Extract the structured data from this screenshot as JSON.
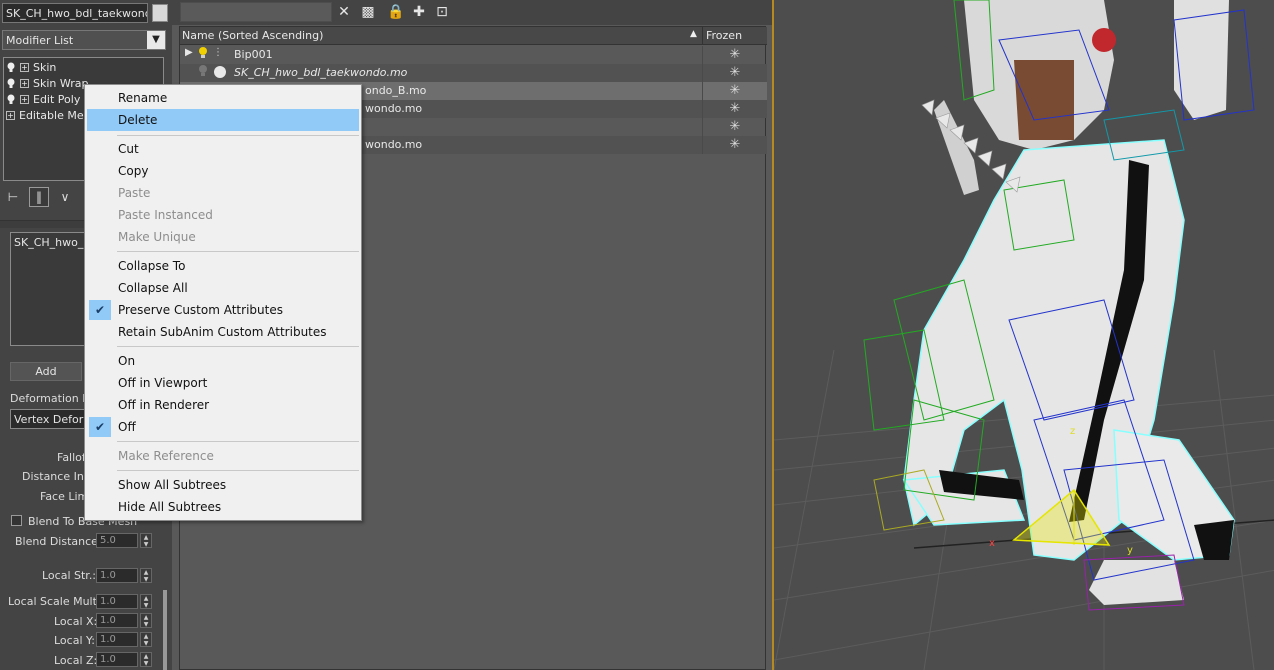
{
  "command_panel": {
    "object_name": "SK_CH_hwo_bdl_taekwondo_",
    "modifier_list_label": "Modifier List",
    "stack": [
      "Skin",
      "Skin Wrap",
      "Edit Poly",
      "Editable Mesh"
    ],
    "list_item": "SK_CH_hwo_b",
    "add_button": "Add",
    "deformation_label": "Deformation En",
    "deformation_value": "Vertex Deform",
    "falloff_label": "Fallof",
    "distance_infl_label": "Distance Infl",
    "face_limit_label": "Face Limi",
    "blend_to_base_label": "Blend To Base Mesh",
    "blend_distance_label": "Blend Distance:",
    "blend_distance_value": "5.0",
    "local_str_label": "Local Str.:",
    "local_str_value": "1.0",
    "local_scale_label": "Local Scale Mult.:",
    "local_scale_value": "1.0",
    "local_x_label": "Local X:",
    "local_x_value": "1.0",
    "local_y_label": "Local Y:",
    "local_y_value": "1.0",
    "local_z_label": "Local Z:",
    "local_z_value": "1.0"
  },
  "scene_explorer": {
    "search_value": "",
    "col_name": "Name (Sorted Ascending)",
    "col_frozen": "Frozen",
    "rows": [
      {
        "name": "Bip001"
      },
      {
        "name": "SK_CH_hwo_bdl_taekwondo.mo"
      },
      {
        "name": "ondo_B.mo"
      },
      {
        "name": "wondo.mo"
      },
      {
        "name": ""
      },
      {
        "name": "wondo.mo"
      }
    ]
  },
  "context_menu": {
    "items": [
      {
        "label": "Rename",
        "state": "normal"
      },
      {
        "label": "Delete",
        "state": "highlighted"
      },
      {
        "label": "Cut",
        "state": "normal"
      },
      {
        "label": "Copy",
        "state": "normal"
      },
      {
        "label": "Paste",
        "state": "disabled"
      },
      {
        "label": "Paste Instanced",
        "state": "disabled"
      },
      {
        "label": "Make Unique",
        "state": "disabled"
      },
      {
        "label": "Collapse To",
        "state": "normal"
      },
      {
        "label": "Collapse All",
        "state": "normal"
      },
      {
        "label": "Preserve Custom Attributes",
        "state": "checked"
      },
      {
        "label": "Retain SubAnim Custom Attributes",
        "state": "normal"
      },
      {
        "label": "On",
        "state": "normal"
      },
      {
        "label": "Off in Viewport",
        "state": "normal"
      },
      {
        "label": "Off in Renderer",
        "state": "normal"
      },
      {
        "label": "Off",
        "state": "checked"
      },
      {
        "label": "Make Reference",
        "state": "disabled"
      },
      {
        "label": "Show All Subtrees",
        "state": "normal"
      },
      {
        "label": "Hide All Subtrees",
        "state": "normal"
      }
    ]
  },
  "viewport": {
    "axis_labels": [
      "x",
      "y",
      "z"
    ],
    "accent_color": "#b78a21",
    "highlight_color": "#91c9f7"
  }
}
